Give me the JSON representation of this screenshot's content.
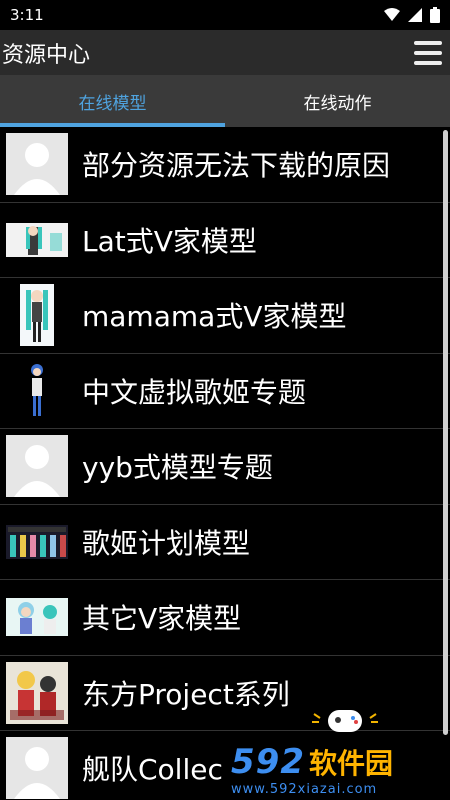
{
  "status": {
    "time": "3:11"
  },
  "app": {
    "title": "资源中心"
  },
  "tabs": [
    {
      "label": "在线模型",
      "active": true
    },
    {
      "label": "在线动作",
      "active": false
    }
  ],
  "items": [
    {
      "label": "部分资源无法下载的原因",
      "thumb": "placeholder-avatar"
    },
    {
      "label": "Lat式V家模型",
      "thumb": "model-image"
    },
    {
      "label": "mamama式V家模型",
      "thumb": "model-image"
    },
    {
      "label": "中文虚拟歌姬专题",
      "thumb": "model-image"
    },
    {
      "label": "yyb式模型专题",
      "thumb": "placeholder-avatar"
    },
    {
      "label": "歌姬计划模型",
      "thumb": "model-image"
    },
    {
      "label": "其它V家模型",
      "thumb": "model-image"
    },
    {
      "label": "东方Project系列",
      "thumb": "model-image"
    },
    {
      "label": "舰队Collec",
      "thumb": "placeholder-avatar"
    }
  ],
  "watermark": {
    "brand_num": "592",
    "brand_cn": "软件园",
    "url": "www.592xiazai.com"
  },
  "colors": {
    "accent": "#4fa3df",
    "appbar": "#2b2b2b",
    "tabbar": "#3a3a3a"
  }
}
